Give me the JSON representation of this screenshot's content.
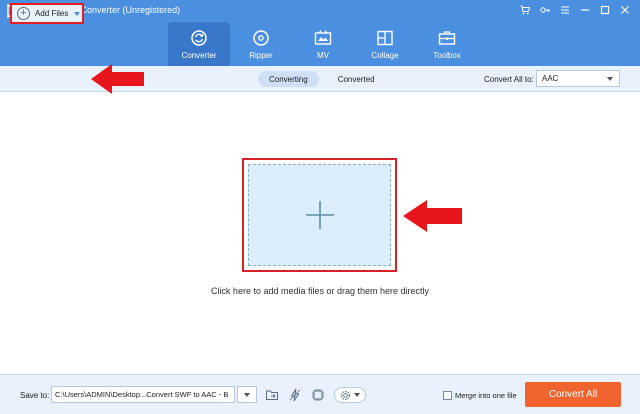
{
  "app": {
    "title": "AVAide Video Converter (Unregistered)",
    "accent": "#4a8fe0",
    "window_controls": [
      "cart-icon",
      "key-icon",
      "menu-icon",
      "minimize-icon",
      "maximize-icon",
      "close-icon"
    ]
  },
  "nav": {
    "tabs": [
      {
        "label": "Converter",
        "icon": "converter-icon",
        "active": true
      },
      {
        "label": "Ripper",
        "icon": "ripper-icon",
        "active": false
      },
      {
        "label": "MV",
        "icon": "mv-icon",
        "active": false
      },
      {
        "label": "Collage",
        "icon": "collage-icon",
        "active": false
      },
      {
        "label": "Toolbox",
        "icon": "toolbox-icon",
        "active": false
      }
    ]
  },
  "toolbar": {
    "add_files_label": "Add Files",
    "segments": [
      {
        "label": "Converting",
        "active": true
      },
      {
        "label": "Converted",
        "active": false
      }
    ],
    "convert_all_label": "Convert All to:",
    "convert_all_value": "AAC"
  },
  "main": {
    "hint": "Click here to add media files or drag them here directly",
    "highlight_color": "#e21d24"
  },
  "bottom": {
    "save_to_label": "Save to:",
    "save_path": "C:\\Users\\ADMIN\\Desktop...Convert SWF to AAC - B",
    "merge_label": "Merge into one file",
    "merge_checked": false,
    "convert_button_label": "Convert All",
    "convert_button_color": "#f2642d"
  }
}
